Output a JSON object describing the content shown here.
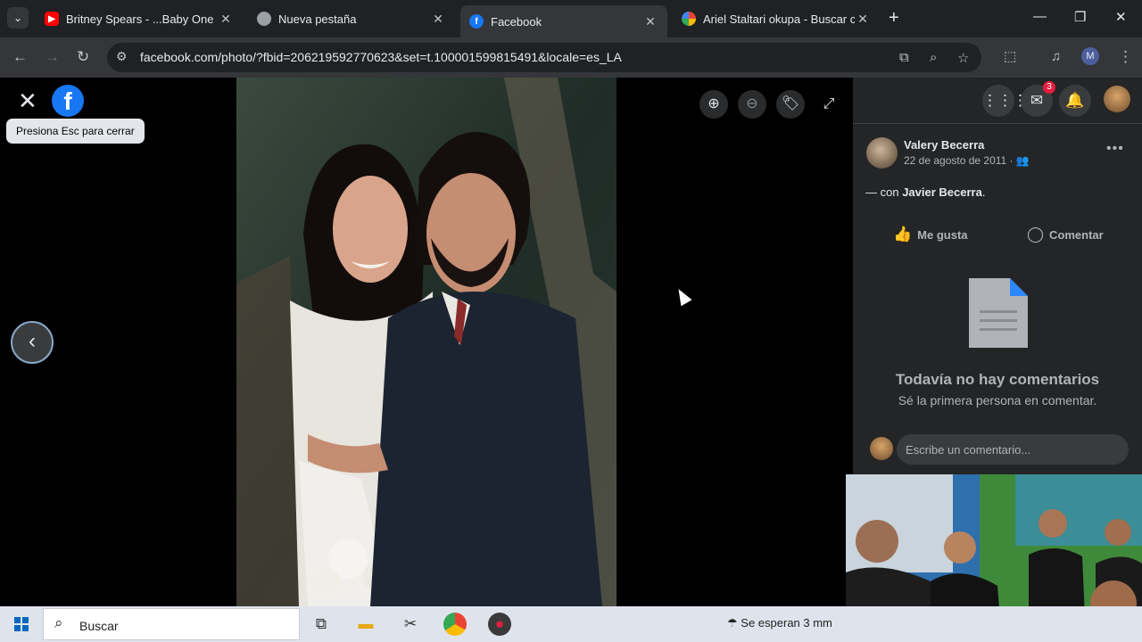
{
  "browser": {
    "tabs": [
      {
        "title": "Britney Spears - ...Baby One Mo",
        "icon": "youtube-icon",
        "active": false
      },
      {
        "title": "Nueva pestaña",
        "icon": "chrome-icon",
        "active": false
      },
      {
        "title": "Facebook",
        "icon": "facebook-icon",
        "active": true
      },
      {
        "title": "Ariel Staltari okupa - Buscar cor",
        "icon": "google-icon",
        "active": false
      }
    ],
    "url": "facebook.com/photo/?fbid=206219592770623&set=t.100001599815491&locale=es_LA",
    "profile_initial": "M"
  },
  "viewer": {
    "esc_tooltip": "Presiona Esc para cerrar",
    "logo": "f"
  },
  "sidebar": {
    "notification_count": "3",
    "post": {
      "author": "Valery Becerra",
      "date": "22 de agosto de 2011 · ",
      "with_prefix": "— con ",
      "with_name": "Javier Becerra",
      "with_suffix": "."
    },
    "actions": {
      "like": "Me gusta",
      "comment": "Comentar"
    },
    "empty": {
      "title": "Todavía no hay comentarios",
      "subtitle": "Sé la primera persona en comentar."
    },
    "comment_placeholder": "Escribe un comentario..."
  },
  "taskbar": {
    "search_label": "Buscar",
    "weather": "Se esperan 3 mm"
  },
  "colors": {
    "facebook_blue": "#1877f2",
    "sidebar_bg": "#242526",
    "notification_red": "#e41e3f"
  }
}
